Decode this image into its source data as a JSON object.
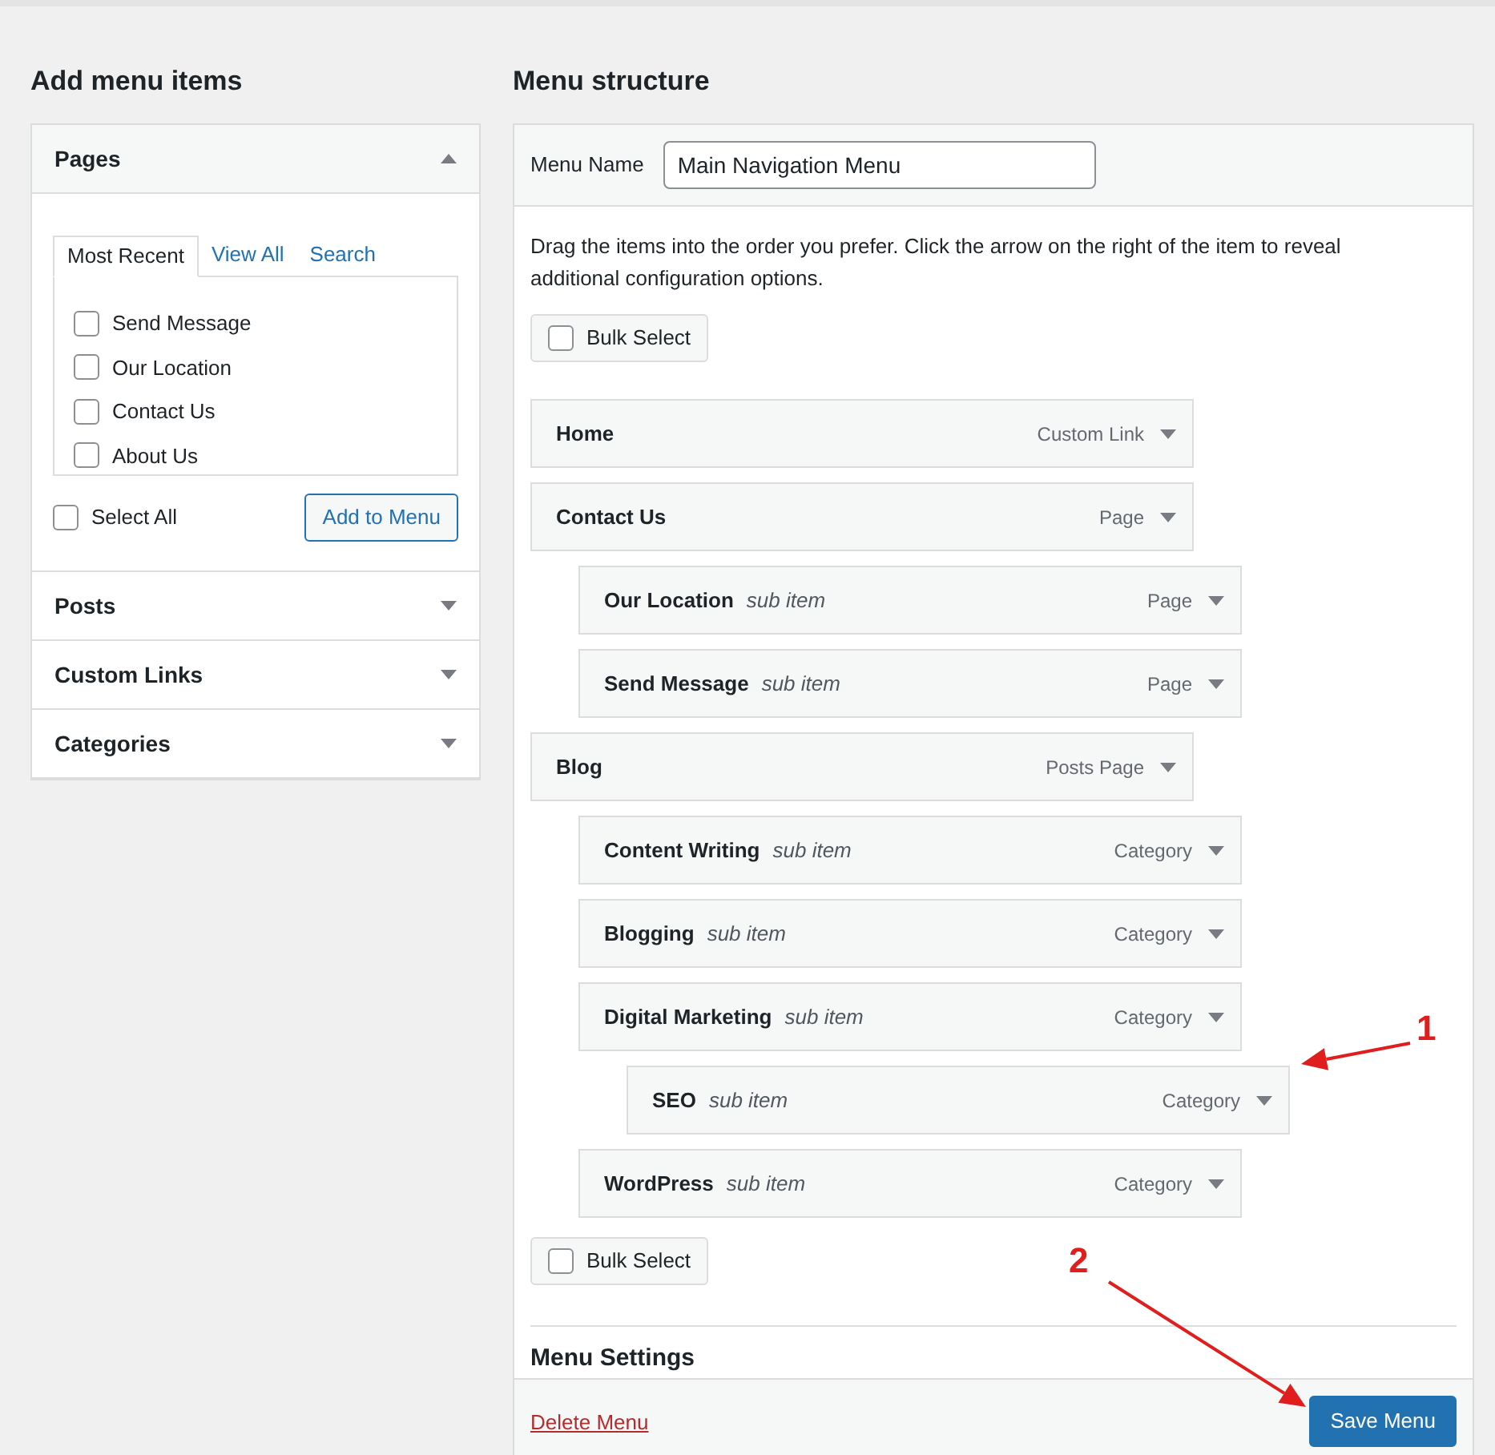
{
  "left": {
    "heading": "Add menu items",
    "sections": [
      {
        "title": "Pages",
        "expanded": true,
        "tabs": [
          {
            "label": "Most Recent",
            "selected": true
          },
          {
            "label": "View All",
            "selected": false
          },
          {
            "label": "Search",
            "selected": false
          }
        ],
        "items": [
          {
            "label": "Send Message",
            "checked": false
          },
          {
            "label": "Our Location",
            "checked": false
          },
          {
            "label": "Contact Us",
            "checked": false
          },
          {
            "label": "About Us",
            "checked": false
          }
        ],
        "select_all": {
          "label": "Select All",
          "checked": false
        },
        "add_button": "Add to Menu"
      },
      {
        "title": "Posts",
        "expanded": false
      },
      {
        "title": "Custom Links",
        "expanded": false
      },
      {
        "title": "Categories",
        "expanded": false
      }
    ]
  },
  "right": {
    "heading": "Menu structure",
    "menu_name": {
      "label": "Menu Name",
      "value": "Main Navigation Menu"
    },
    "instructions": "Drag the items into the order you prefer. Click the arrow on the right of the item to reveal additional configuration options.",
    "bulk_select": {
      "label": "Bulk Select",
      "checked": false
    },
    "items": [
      {
        "title": "Home",
        "type": "Custom Link"
      },
      {
        "title": "Contact Us",
        "type": "Page",
        "children": [
          {
            "title": "Our Location",
            "sub_label": "sub item",
            "type": "Page"
          },
          {
            "title": "Send Message",
            "sub_label": "sub item",
            "type": "Page"
          }
        ]
      },
      {
        "title": "Blog",
        "type": "Posts Page",
        "children": [
          {
            "title": "Content Writing",
            "sub_label": "sub item",
            "type": "Category"
          },
          {
            "title": "Blogging",
            "sub_label": "sub item",
            "type": "Category"
          },
          {
            "title": "Digital Marketing",
            "sub_label": "sub item",
            "type": "Category",
            "children": [
              {
                "title": "SEO",
                "sub_label": "sub item",
                "type": "Category"
              }
            ]
          },
          {
            "title": "WordPress",
            "sub_label": "sub item",
            "type": "Category"
          }
        ]
      }
    ],
    "bulk_select_bottom": {
      "label": "Bulk Select",
      "checked": false
    },
    "settings_heading": "Menu Settings",
    "delete_link": "Delete Menu",
    "save_button": "Save Menu"
  },
  "annotations": [
    {
      "label": "1"
    },
    {
      "label": "2"
    }
  ]
}
